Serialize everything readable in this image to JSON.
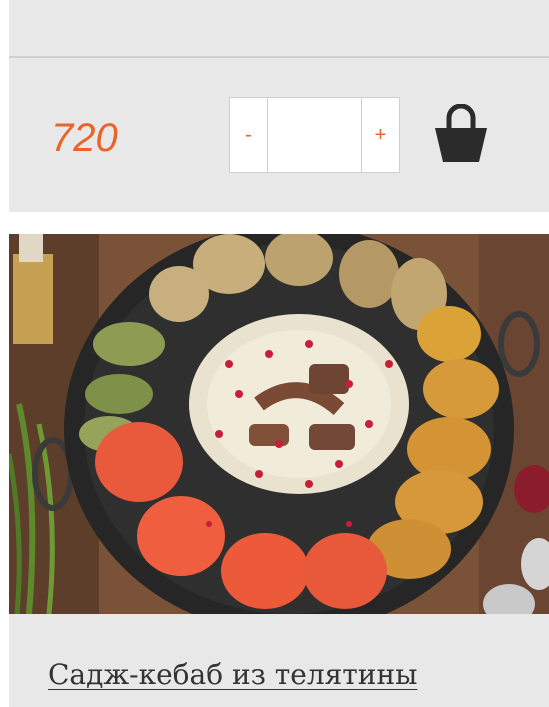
{
  "product": {
    "price": "720",
    "quantity_value": "",
    "minus_label": "-",
    "plus_label": "+",
    "title": "Садж-кебаб из телятины",
    "cart_icon": "shopping-basket-icon",
    "image_alt": "dish-photo"
  },
  "colors": {
    "accent": "#e8642a",
    "card_bg": "#e8e8e8",
    "title_text": "#333333",
    "icon": "#2b2b2b"
  }
}
